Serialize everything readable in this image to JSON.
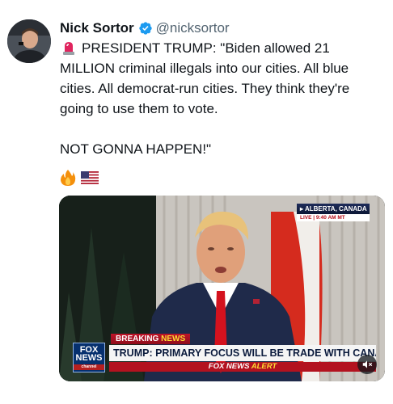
{
  "author": {
    "name": "Nick Sortor",
    "handle": "@nicksortor",
    "verified_color": "#1d9bf0"
  },
  "tweet": {
    "lines": [
      "PRESIDENT TRUMP: \"Biden allowed 21 MILLION criminal illegals into our cities. All blue cities. All democrat-run cities. They think they're going to use them to vote.",
      "NOT GONNA HAPPEN!\""
    ],
    "leading_icon": "siren-icon",
    "trailing_emojis": [
      "fire-icon",
      "us-flag-icon"
    ]
  },
  "video": {
    "location": "ALBERTA, CANADA",
    "live_label": "LIVE",
    "time": "9:40 AM MT",
    "breaking_label": "BREAKING",
    "breaking_news_label": "NEWS",
    "headline": "TRUMP: PRIMARY FOCUS WILL BE TRADE WITH CANADA",
    "network_logo_line1": "FOX",
    "network_logo_line2": "NEWS",
    "network_logo_line3": "channel",
    "alert_part1": "FOX NEWS",
    "alert_part2": "ALERT",
    "mute_icon": "volume-muted-icon"
  }
}
